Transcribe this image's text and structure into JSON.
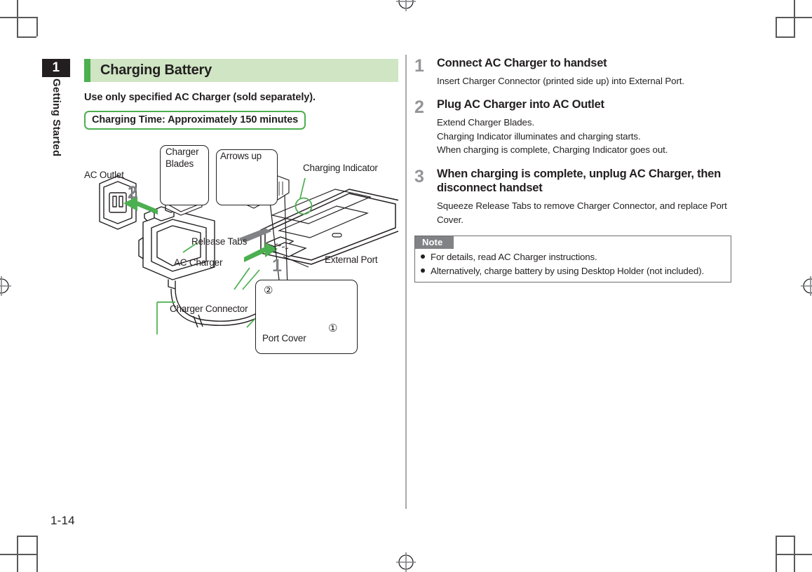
{
  "page": {
    "folio": "1-14",
    "chapter_number": "1",
    "chapter_name": "Getting Started"
  },
  "section": {
    "title": "Charging Battery",
    "accent_color": "#4caf50",
    "header_bg": "#cfe5c3",
    "lead": "Use only specified AC Charger (sold separately).",
    "time_box": "Charging Time: Approximately 150 minutes"
  },
  "figure": {
    "labels": {
      "ac_outlet": "AC Outlet",
      "charger_blades": "Charger\nBlades",
      "charger_blades_line1": "Charger",
      "charger_blades_line2": "Blades",
      "arrows_up": "Arrows up",
      "charging_indicator": "Charging Indicator",
      "release_tabs": "Release Tabs",
      "ac_charger": "AC Charger",
      "charger_connector": "Charger Connector",
      "external_port": "External Port",
      "port_cover": "Port Cover"
    },
    "step_markers": {
      "marker_1": "1",
      "marker_2": "2",
      "circled_1": "①",
      "circled_2": "②"
    }
  },
  "steps": [
    {
      "number": "1",
      "title": "Connect AC Charger to handset",
      "desc": "Insert Charger Connector (printed side up) into External Port."
    },
    {
      "number": "2",
      "title": "Plug AC Charger into AC Outlet",
      "desc": "Extend Charger Blades.\nCharging Indicator illuminates and charging starts.\nWhen charging is complete, Charging Indicator goes out."
    },
    {
      "number": "3",
      "title": "When charging is complete, unplug AC Charger, then disconnect handset",
      "desc": "Squeeze Release Tabs to remove Charger Connector, and replace Port Cover."
    }
  ],
  "note": {
    "heading": "Note",
    "items": [
      "For details, read AC Charger instructions.",
      "Alternatively, charge battery by using Desktop Holder (not included)."
    ]
  }
}
